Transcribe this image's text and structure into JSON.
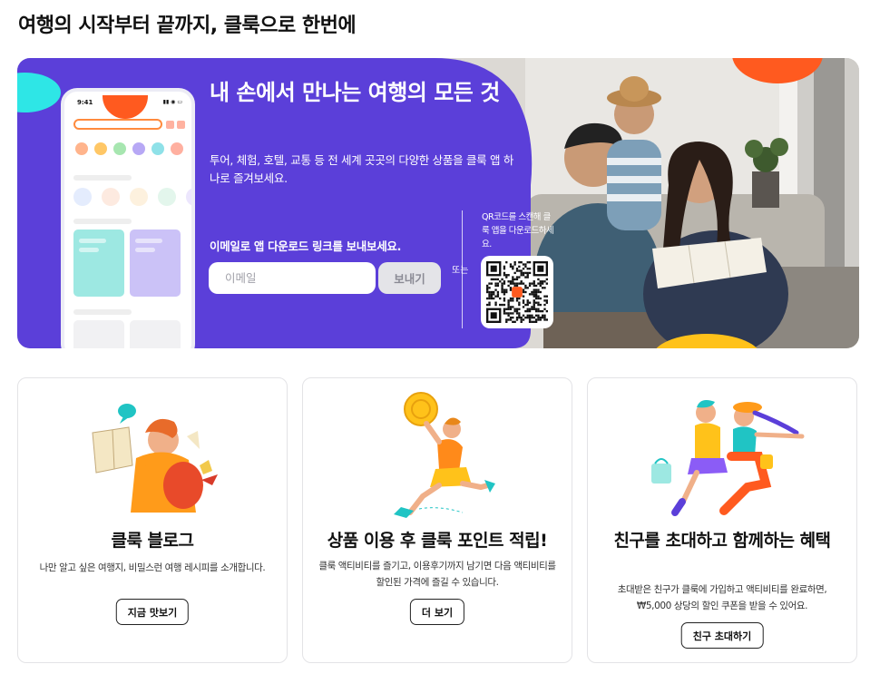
{
  "page": {
    "section_title": "여행의 시작부터 끝까지, 클룩으로 한번에"
  },
  "banner": {
    "headline": "내 손에서 만나는 여행의 모든 것",
    "description": "투어, 체험, 호텔, 교통 등 전 세계 곳곳의 다양한 상품을 클룩 앱 하나로 즐겨보세요.",
    "email_label": "이메일로 앱 다운로드 링크를 보내보세요.",
    "email_placeholder": "이메일",
    "email_value": "",
    "send_button": "보내기",
    "or_text": "또는",
    "qr_caption": "QR코드를 스캔해 클룩 앱을 다운로드하세요.",
    "phone_time": "9:41",
    "colors": {
      "purple": "#5b3fd9",
      "orange": "#ff5a1f",
      "cyan": "#2ee6e6",
      "yellow": "#ffc21a"
    }
  },
  "cards": [
    {
      "title": "클룩 블로그",
      "description": "나만 알고 싶은 여행지, 비밀스런 여행 레시피를 소개합니다.",
      "button": "지금 맛보기",
      "illustration": "person-reading-map-illustration"
    },
    {
      "title": "상품 이용 후 클룩 포인트 적립!",
      "description": "클룩 액티비티를 즐기고, 이용후기까지 남기면 다음 액티비티를 할인된 가격에 즐길 수 있습니다.",
      "button": "더 보기",
      "illustration": "person-running-with-coin-illustration"
    },
    {
      "title": "친구를 초대하고 함께하는 혜택",
      "description": "초대받은 친구가 클룩에 가입하고 액티비티를 완료하면, ₩5,000 상당의 할인 쿠폰을 받을 수 있어요.",
      "button": "친구 초대하기",
      "illustration": "friends-shopping-illustration"
    }
  ]
}
